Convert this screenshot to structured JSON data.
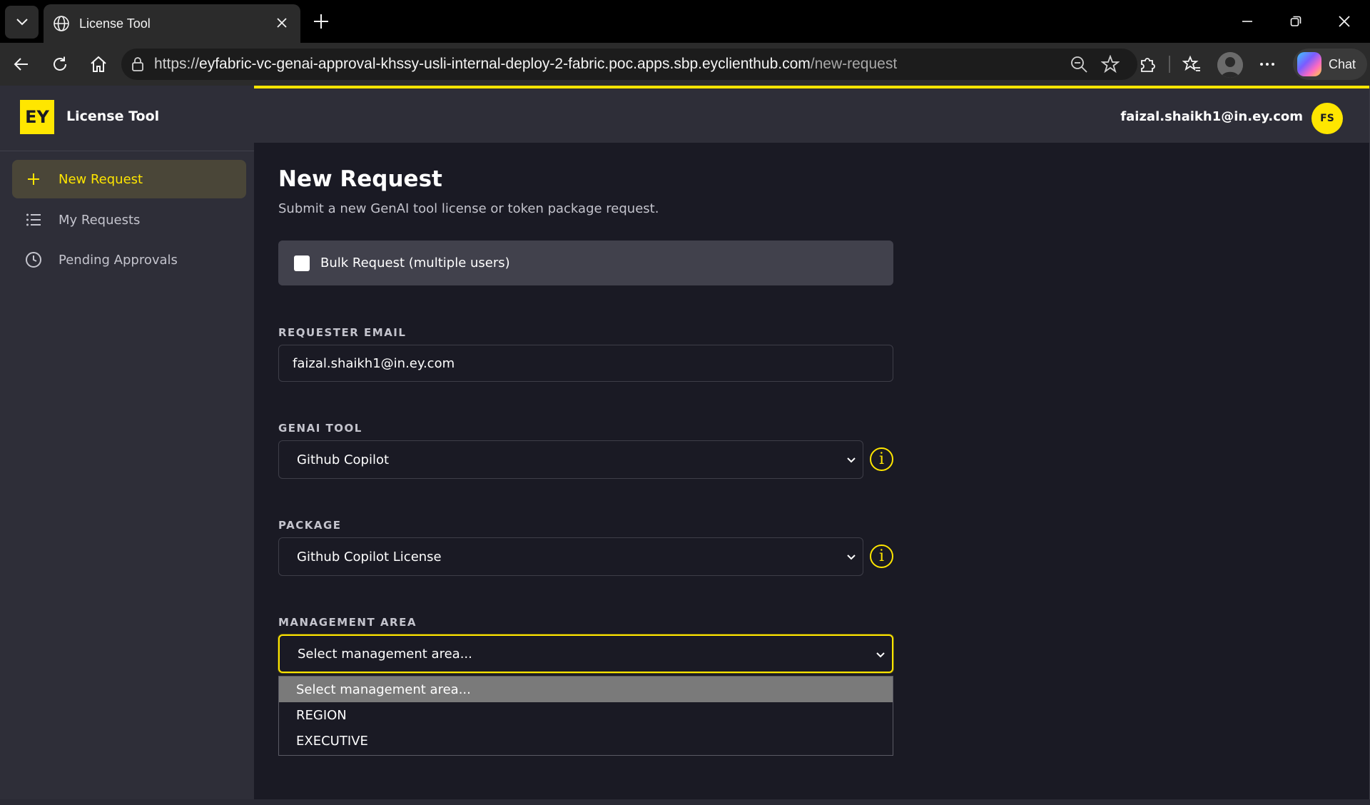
{
  "browser": {
    "tab_title": "License Tool",
    "url_scheme": "https://",
    "url_host": "eyfabric-vc-genai-approval-khssy-usli-internal-deploy-2-fabric.poc.apps.sbp.eyclienthub.com",
    "url_path": "/new-request",
    "chat_label": "Chat"
  },
  "sidebar": {
    "logo_text": "EY",
    "app_name": "License Tool",
    "items": [
      {
        "label": "New Request",
        "icon": "plus-icon",
        "active": true
      },
      {
        "label": "My Requests",
        "icon": "list-icon",
        "active": false
      },
      {
        "label": "Pending Approvals",
        "icon": "clock-icon",
        "active": false
      }
    ]
  },
  "header": {
    "user_email": "faizal.shaikh1@in.ey.com",
    "user_initials": "FS"
  },
  "page": {
    "title": "New Request",
    "subtitle": "Submit a new GenAI tool license or token package request."
  },
  "form": {
    "bulk_label": "Bulk Request (multiple users)",
    "bulk_checked": false,
    "requester_email_label": "REQUESTER EMAIL",
    "requester_email_value": "faizal.shaikh1@in.ey.com",
    "genai_tool_label": "GENAI TOOL",
    "genai_tool_value": "Github Copilot",
    "package_label": "PACKAGE",
    "package_value": "Github Copilot License",
    "management_area_label": "MANAGEMENT AREA",
    "management_area_value": "Select management area...",
    "management_area_options": [
      "Select management area...",
      "REGION",
      "EXECUTIVE"
    ]
  },
  "colors": {
    "accent": "#ffe600",
    "app_bg": "#1a1a24",
    "panel_bg": "#2e2e38"
  }
}
